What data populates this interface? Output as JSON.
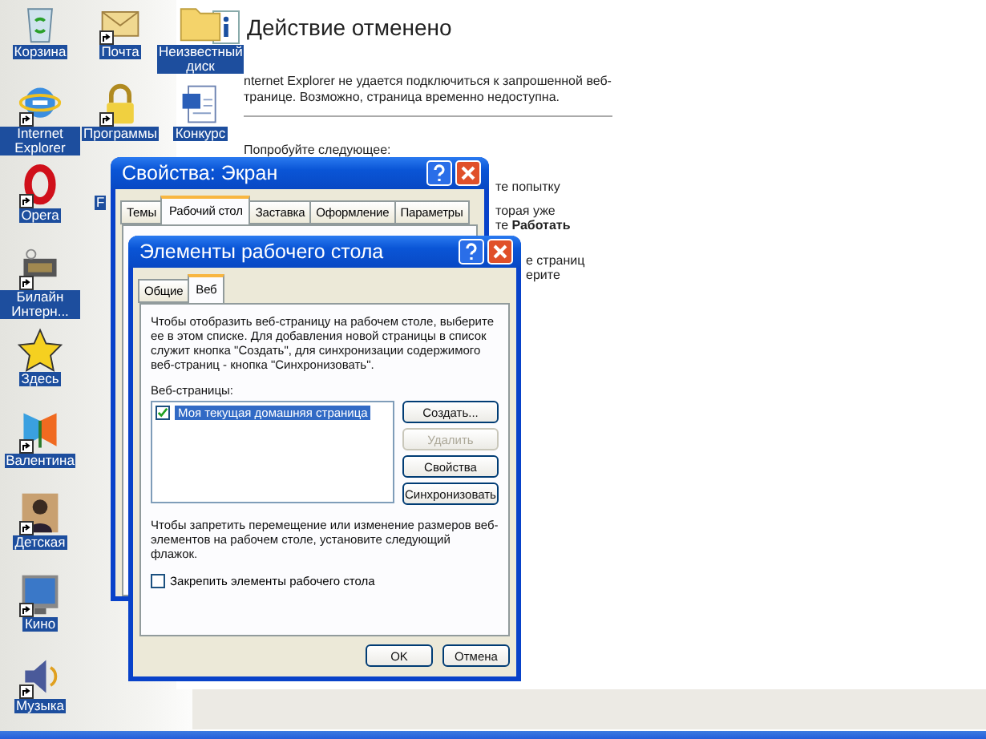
{
  "desktop_icon_columns": [
    [
      {
        "label": "Корзина",
        "kind": "recycle",
        "shortcut": false,
        "selected": true
      },
      {
        "label": "Internet Explorer",
        "kind": "globe",
        "shortcut": true,
        "selected": true
      },
      {
        "label": "Opera",
        "kind": "opera",
        "shortcut": true,
        "selected": true
      },
      {
        "label": "Билайн Интерн...",
        "kind": "modem",
        "shortcut": true,
        "selected": true
      },
      {
        "label": "Здесь",
        "kind": "star",
        "shortcut": false,
        "selected": true
      },
      {
        "label": "Валентина",
        "kind": "butterfly",
        "shortcut": true,
        "selected": true
      },
      {
        "label": "Детская",
        "kind": "photo",
        "shortcut": true,
        "selected": true
      },
      {
        "label": "Кино",
        "kind": "monitor",
        "shortcut": true,
        "selected": true
      },
      {
        "label": "Музыка",
        "kind": "speaker",
        "shortcut": true,
        "selected": true
      }
    ],
    [
      {
        "label": "Почта",
        "kind": "mail",
        "shortcut": true,
        "selected": true
      },
      {
        "label": "Программы",
        "kind": "lock",
        "shortcut": true,
        "selected": true
      },
      {
        "label": "F",
        "kind": "covered",
        "selected": true
      }
    ],
    [
      {
        "label": "Неизвестный диск",
        "kind": "folder",
        "shortcut": false,
        "selected": true
      },
      {
        "label": "Конкурс",
        "kind": "document",
        "shortcut": false,
        "selected": true
      }
    ]
  ],
  "browser_page": {
    "title": "Действие отменено",
    "message_lines": [
      "nternet Explorer не удается подключиться к запрошенной веб-",
      "транице. Возможно, страница временно недоступна."
    ],
    "suggestions_heading": "Попробуйте следующее:",
    "cut_fragments": [
      "те попытку",
      "торая уже",
      "те **Работать**",
      "е страниц",
      "ерите"
    ]
  },
  "display_properties": {
    "title": "Свойства: Экран",
    "tabs": [
      {
        "label": "Темы",
        "selected": false
      },
      {
        "label": "Рабочий стол",
        "selected": true
      },
      {
        "label": "Заставка",
        "selected": false
      },
      {
        "label": "Оформление",
        "selected": false
      },
      {
        "label": "Параметры",
        "selected": false
      }
    ]
  },
  "desktop_items_dialog": {
    "title": "Элементы рабочего стола",
    "tabs": [
      {
        "label": "Общие",
        "selected": false
      },
      {
        "label": "Веб",
        "selected": true
      }
    ],
    "description": "Чтобы отобразить веб-страницу на рабочем столе, выберите ее в этом списке. Для добавления новой страницы в список служит кнопка \"Создать\", для синхронизации содержимого веб-страниц - кнопка \"Синхронизовать\".",
    "list_label": "Веб-страницы:",
    "web_pages": [
      {
        "label": "Моя текущая домашняя страница",
        "checked": true,
        "selected": true
      }
    ],
    "side_buttons": [
      {
        "label": "Создать...",
        "disabled": false
      },
      {
        "label": "Удалить",
        "disabled": true
      },
      {
        "label": "Свойства",
        "disabled": false
      },
      {
        "label": "Синхронизовать",
        "disabled": false
      }
    ],
    "lock_text": "Чтобы запретить перемещение или изменение размеров веб-элементов на рабочем столе, установите следующий флажок.",
    "lock_checkbox": {
      "label": "Закрепить элементы рабочего стола",
      "checked": false
    },
    "footer_buttons": [
      "OK",
      "Отмена"
    ]
  }
}
